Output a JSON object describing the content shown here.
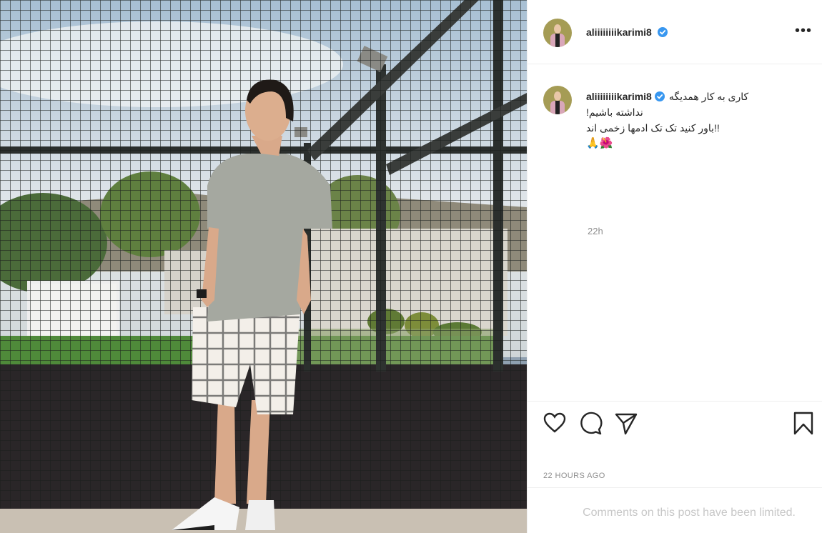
{
  "post": {
    "photo_icon": "post-photo",
    "author": {
      "username": "aliiiiiiiikarimi8",
      "verified_icon": "verified-badge-icon"
    },
    "more_icon": "more-options-icon",
    "more_label": "•••",
    "caption": {
      "line1": "کاری به کار همدیگه",
      "line2": "!نداشته باشیم",
      "line3": "باور کنید تک تک ادمها زخمی اند!!",
      "line4": "🙏🌺",
      "age": "22h"
    },
    "actions": {
      "like_icon": "heart-icon",
      "comment_icon": "comment-icon",
      "share_icon": "share-icon",
      "save_icon": "bookmark-icon"
    },
    "timestamp": "22 HOURS AGO",
    "comments_notice": "Comments on this post have been limited."
  },
  "colors": {
    "accent_blue": "#3897f0",
    "text": "#262626",
    "muted": "#8e8e8e",
    "border": "#efefef"
  }
}
